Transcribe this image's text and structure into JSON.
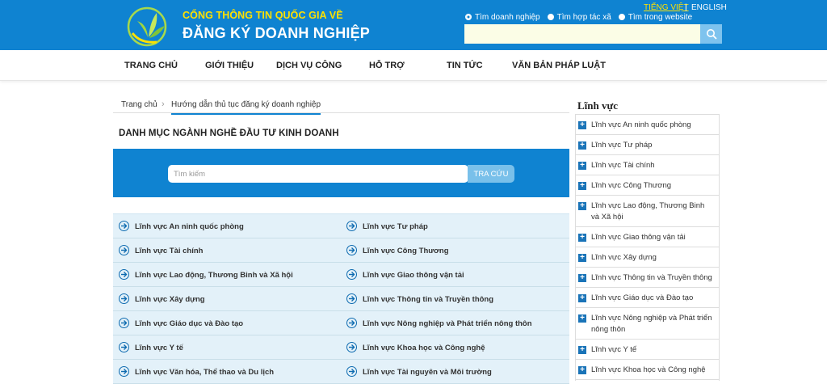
{
  "header": {
    "title_line1": "CỔNG THÔNG TIN QUỐC GIA VỀ",
    "title_line2": "ĐĂNG KÝ DOANH NGHIỆP",
    "lang_vi": "TIẾNG VIỆT",
    "lang_sep": "|",
    "lang_en": "ENGLISH",
    "radio_options": [
      "Tìm doanh nghiệp",
      "Tìm hợp tác xã",
      "Tìm trong website"
    ],
    "radio_selected": "Tìm doanh nghiệp",
    "search_value": "",
    "search_icon": "search-icon",
    "colors": {
      "header_bg": "#0f83d1",
      "title_yellow": "#ffe100"
    }
  },
  "nav": {
    "items": [
      "TRANG CHỦ",
      "GIỚI THIỆU",
      "DỊCH VỤ CÔNG",
      "HỖ TRỢ",
      "TIN TỨC",
      "VĂN BẢN PHÁP LUẬT"
    ]
  },
  "breadcrumb": {
    "home": "Trang chủ",
    "separator": "›",
    "current": "Hướng dẫn thủ tục đăng ký doanh nghiệp"
  },
  "main": {
    "title": "DANH MỤC NGÀNH NGHỀ ĐẦU TƯ KINH DOANH",
    "search_placeholder": "Tìm kiếm",
    "search_button": "TRA CỨU",
    "fields": [
      "Lĩnh vực An ninh quốc phòng",
      "Lĩnh vực Tư pháp",
      "Lĩnh vực Tài chính",
      "Lĩnh vực Công Thương",
      "Lĩnh vực Lao động, Thương Binh và Xã hội",
      "Lĩnh vực Giao thông vận tải",
      "Lĩnh vực Xây dựng",
      "Lĩnh vực Thông tin và Truyền thông",
      "Lĩnh vực Giáo dục và Đào tạo",
      "Lĩnh vực Nông nghiệp và Phát triển nông thôn",
      "Lĩnh vực Y tế",
      "Lĩnh vực Khoa học và Công nghệ",
      "Lĩnh vực Văn hóa, Thể thao và Du lịch",
      "Lĩnh vực Tài nguyên và Môi trường"
    ]
  },
  "sidebar": {
    "title": "Lĩnh vực",
    "items": [
      "Lĩnh vực An ninh quốc phòng",
      "Lĩnh vực Tư pháp",
      "Lĩnh vực Tài chính",
      "Lĩnh vực Công Thương",
      "Lĩnh vực Lao động, Thương Binh và Xã hội",
      "Lĩnh vực Giao thông vận tải",
      "Lĩnh vực Xây dựng",
      "Lĩnh vực Thông tin và Truyền thông",
      "Lĩnh vực Giáo dục và Đào tạo",
      "Lĩnh vực Nông nghiệp và Phát triển nông thôn",
      "Lĩnh vực Y tế",
      "Lĩnh vực Khoa học và Công nghệ"
    ]
  }
}
